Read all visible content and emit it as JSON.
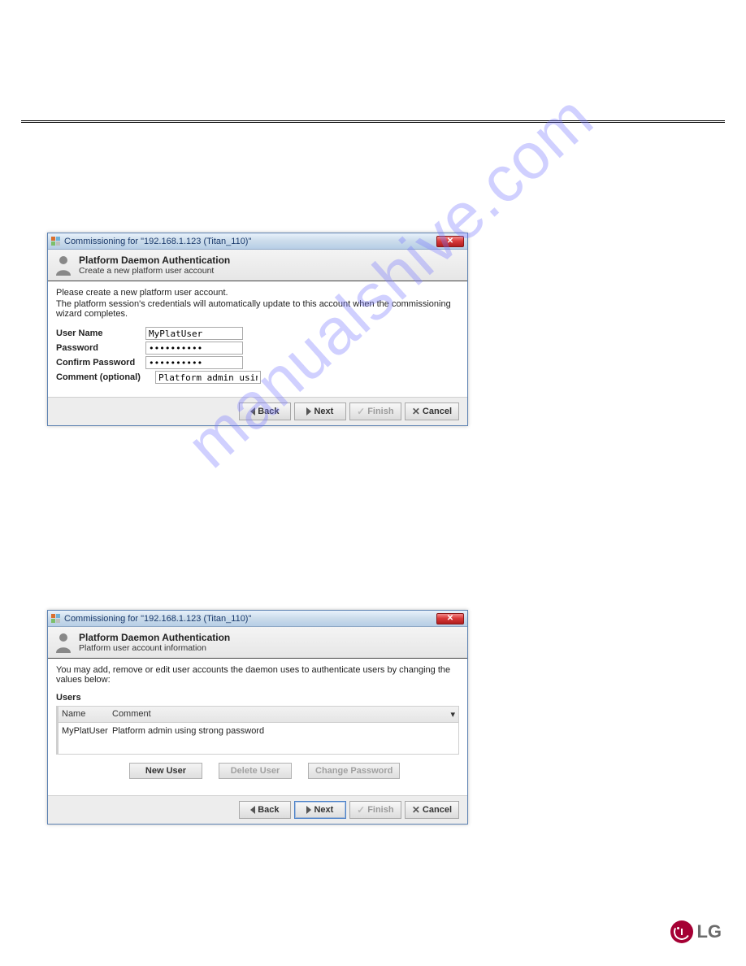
{
  "watermark": "manualshive.com",
  "dialog1": {
    "title": "Commissioning for \"192.168.1.123 (Titan_110)\"",
    "header_title": "Platform Daemon Authentication",
    "header_sub": "Create a new platform user account",
    "instr1": "Please create a new platform user account.",
    "instr2": "The platform session's credentials will automatically update to this account when the commissioning wizard completes.",
    "labels": {
      "user": "User Name",
      "pw": "Password",
      "confirm": "Confirm Password",
      "comment": "Comment (optional)"
    },
    "values": {
      "user": "MyPlatUser",
      "pw": "••••••••••",
      "confirm": "••••••••••",
      "comment": "Platform admin using"
    },
    "buttons": {
      "back": "Back",
      "next": "Next",
      "finish": "Finish",
      "cancel": "Cancel"
    }
  },
  "dialog2": {
    "title": "Commissioning for \"192.168.1.123 (Titan_110)\"",
    "header_title": "Platform Daemon Authentication",
    "header_sub": "Platform user account information",
    "instr": "You may add, remove or edit user accounts the daemon uses to authenticate users by changing the values below:",
    "users_label": "Users",
    "columns": {
      "name": "Name",
      "comment": "Comment"
    },
    "row": {
      "name": "MyPlatUser",
      "comment": "Platform admin using strong password"
    },
    "mid_buttons": {
      "newuser": "New User",
      "deleteuser": "Delete User",
      "changepw": "Change Password"
    },
    "buttons": {
      "back": "Back",
      "next": "Next",
      "finish": "Finish",
      "cancel": "Cancel"
    }
  },
  "logo_text": "LG"
}
